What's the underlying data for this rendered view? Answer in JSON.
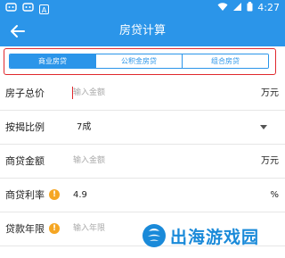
{
  "status_bar": {
    "icons": [
      "notification-icon",
      "notification-icon",
      "a-badge-icon",
      "wifi-icon",
      "signal-icon",
      "battery-icon"
    ],
    "a_badge": "A",
    "time": "4:27"
  },
  "app_bar": {
    "title": "房贷计算",
    "back_icon": "arrow-left-icon"
  },
  "tabs": [
    {
      "label": "商业房贷",
      "active": true
    },
    {
      "label": "公积金房贷",
      "active": false
    },
    {
      "label": "组合房贷",
      "active": false
    }
  ],
  "form": {
    "total_price": {
      "label": "房子总价",
      "placeholder": "输入金额",
      "unit": "万元"
    },
    "mortgage_ratio": {
      "label": "按揭比例",
      "value": "7成"
    },
    "loan_amount": {
      "label": "商贷金额",
      "placeholder": "输入金额",
      "unit": "万元"
    },
    "interest_rate": {
      "label": "商贷利率",
      "value": "4.9",
      "unit": "%"
    },
    "loan_years": {
      "label": "贷款年限",
      "placeholder": "输入年限"
    }
  },
  "watermark": {
    "text": "出海游戏园"
  },
  "colors": {
    "primary": "#2b95e9",
    "highlight_border": "#e0282d",
    "warning": "#f5a623"
  }
}
